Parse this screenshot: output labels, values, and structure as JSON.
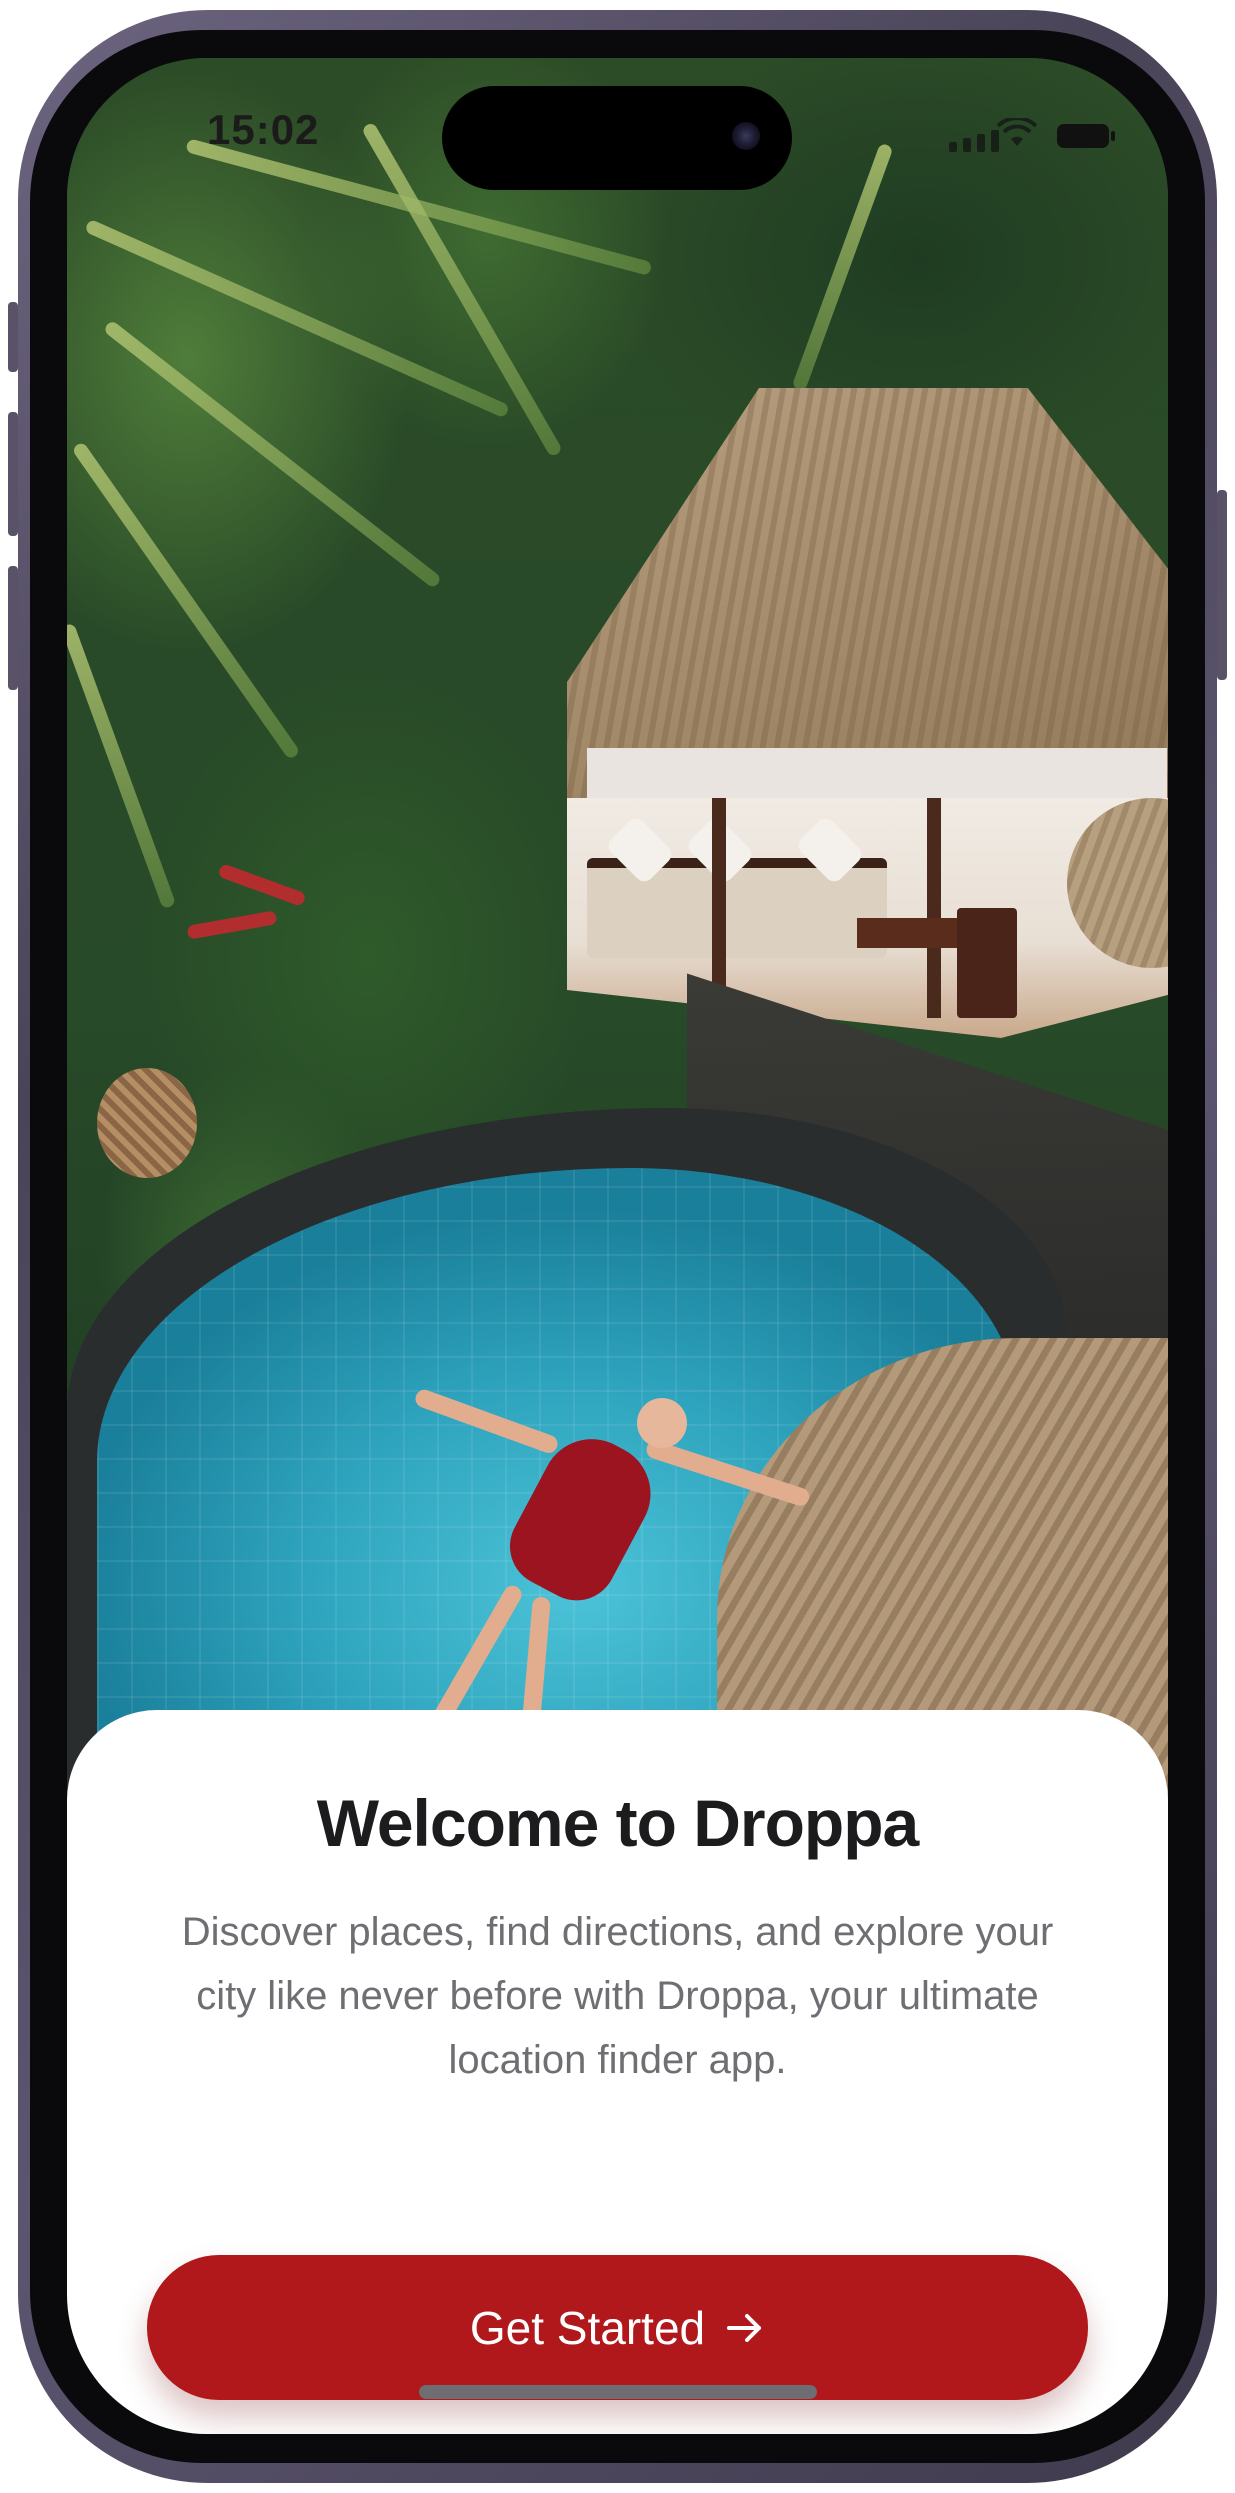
{
  "status_bar": {
    "time": "15:02"
  },
  "welcome": {
    "title": "Welcome to Droppa",
    "description": "Discover places, find directions, and explore your city like never before with Droppa, your ultimate location finder app.",
    "cta_label": "Get Started",
    "cta_icon": "arrow-right-icon",
    "cta_color": "#b0181b"
  },
  "background_photo": {
    "subject": "tropical-villa-pool-photo"
  }
}
